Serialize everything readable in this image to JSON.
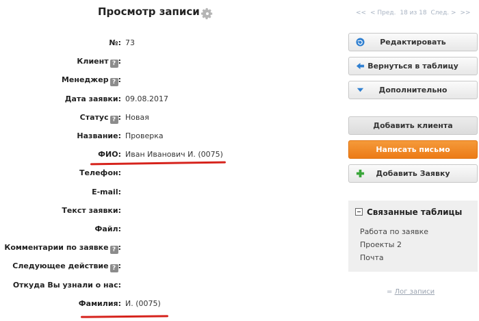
{
  "header": {
    "title": "Просмотр записи",
    "pager": {
      "first": "<<",
      "prev": "< Пред.",
      "counter": "18 из 18",
      "next": "След. >",
      "last": ">>"
    }
  },
  "fields": [
    {
      "label": "№:",
      "value": "73",
      "help": false
    },
    {
      "label": "Клиент",
      "value": "",
      "help": true
    },
    {
      "label": "Менеджер",
      "value": "",
      "help": true
    },
    {
      "label": "Дата заявки:",
      "value": "09.08.2017",
      "help": false
    },
    {
      "label": "Статус",
      "value": "Новая",
      "help": true
    },
    {
      "label": "Название:",
      "value": "Проверка",
      "help": false
    },
    {
      "label": "ФИО:",
      "value": "Иван Иванович И. (0075)",
      "help": false
    },
    {
      "label": "Телефон:",
      "value": "",
      "help": false
    },
    {
      "label": "E-mail:",
      "value": "",
      "help": false
    },
    {
      "label": "Текст заявки:",
      "value": "",
      "help": false
    },
    {
      "label": "Файл:",
      "value": "",
      "help": false
    },
    {
      "label": "Комментарии по заявке",
      "value": "",
      "help": true
    },
    {
      "label": "Следующее действие",
      "value": "",
      "help": true
    },
    {
      "label": "Откуда Вы узнали о нас:",
      "value": "",
      "help": false
    },
    {
      "label": "Фамилия:",
      "value": "И. (0075)",
      "help": false
    }
  ],
  "help_glyph": "?",
  "help_suffix": ":",
  "buttons": {
    "edit": "Редактировать",
    "back": "Вернуться в таблицу",
    "more": "Дополнительно",
    "add_client": "Добавить клиента",
    "write_letter": "Написать письмо",
    "add_request": "Добавить Заявку"
  },
  "related": {
    "title": "Связанные таблицы",
    "items": [
      "Работа по заявке",
      "Проекты 2",
      "Почта"
    ]
  },
  "log": {
    "prefix": "=",
    "label": "Лог записи"
  },
  "colors": {
    "accent_orange": "#ec7b17",
    "highlight_red": "#d6231c",
    "icon_blue": "#2f7fd0",
    "icon_green": "#3aa63a"
  }
}
